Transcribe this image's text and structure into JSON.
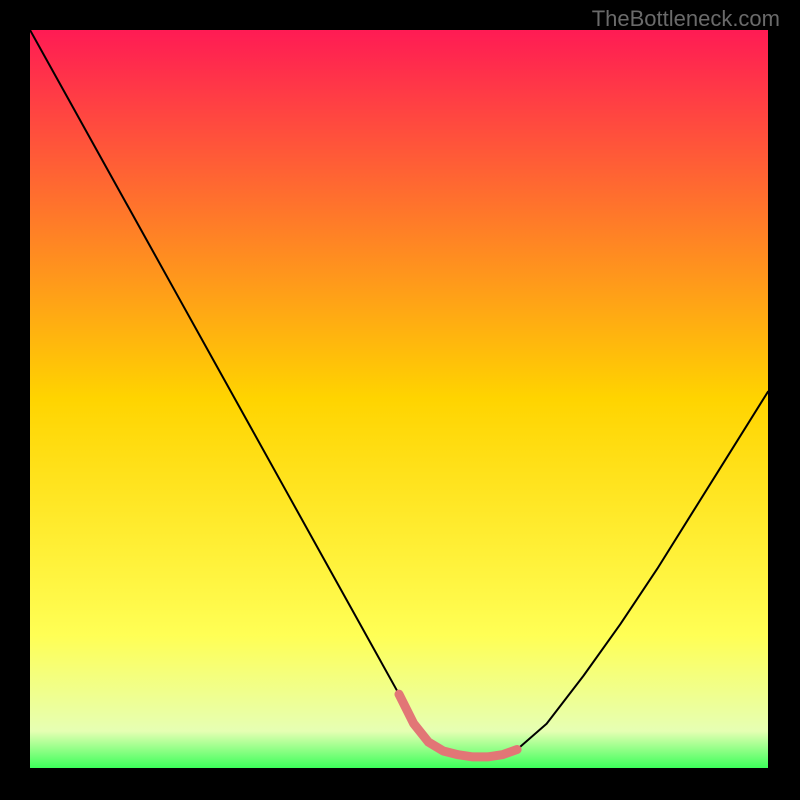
{
  "watermark": "TheBottleneck.com",
  "chart_data": {
    "type": "line",
    "title": "",
    "xlabel": "",
    "ylabel": "",
    "xlim": [
      0,
      100
    ],
    "ylim": [
      0,
      100
    ],
    "grid": false,
    "legend": false,
    "background_gradient_stops": [
      {
        "offset": 0,
        "color": "#ff1b54"
      },
      {
        "offset": 50,
        "color": "#ffd400"
      },
      {
        "offset": 82,
        "color": "#ffff55"
      },
      {
        "offset": 95,
        "color": "#e6ffb3"
      },
      {
        "offset": 100,
        "color": "#3cff5a"
      }
    ],
    "series": [
      {
        "name": "curve",
        "color": "#000000",
        "width": 2,
        "x": [
          0,
          5,
          10,
          15,
          20,
          25,
          30,
          35,
          40,
          45,
          50,
          52,
          54,
          56,
          58,
          60,
          62,
          64,
          66,
          70,
          75,
          80,
          85,
          90,
          95,
          100
        ],
        "y": [
          100,
          91,
          82,
          73,
          64,
          55,
          46,
          37,
          28,
          19,
          10,
          6,
          3.5,
          2.3,
          1.8,
          1.5,
          1.5,
          1.8,
          2.5,
          6,
          12.5,
          19.5,
          27,
          35,
          43,
          51
        ]
      },
      {
        "name": "highlight",
        "color": "#e27676",
        "width": 9,
        "x": [
          50,
          52,
          54,
          56,
          58,
          60,
          62,
          64,
          66
        ],
        "y": [
          10,
          6,
          3.5,
          2.3,
          1.8,
          1.5,
          1.5,
          1.8,
          2.5
        ]
      }
    ]
  }
}
